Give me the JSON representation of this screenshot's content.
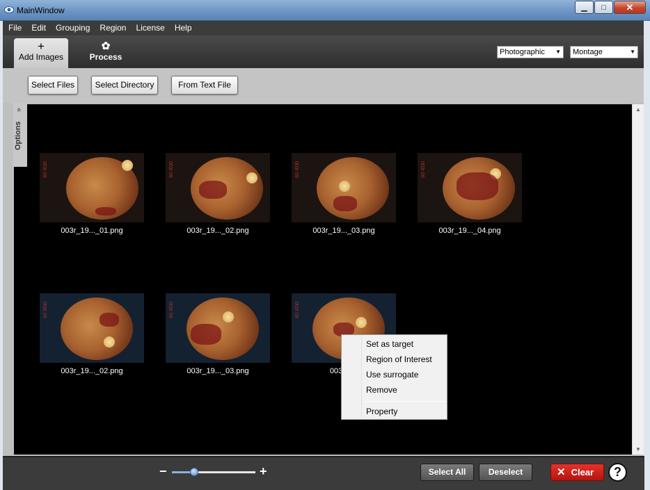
{
  "window": {
    "title": "MainWindow",
    "minimize": "▁",
    "maximize": "□",
    "close": "✕"
  },
  "menu": [
    "File",
    "Edit",
    "Grouping",
    "Region",
    "License",
    "Help"
  ],
  "tabs": {
    "add_images": {
      "icon": "plus-icon",
      "glyph": "+",
      "label": "Add Images"
    },
    "process": {
      "icon": "gear-icon",
      "glyph": "✿",
      "label": "Process"
    }
  },
  "selects": {
    "mode": {
      "value": "Photographic"
    },
    "view": {
      "value": "Montage"
    }
  },
  "buttons": {
    "select_files": "Select Files",
    "select_directory": "Select Directory",
    "from_text_file": "From Text File"
  },
  "options_tab": {
    "label": "Options",
    "chevron": "«"
  },
  "thumbnails": [
    {
      "caption": "003r_19..._01.png",
      "stamp": "003r 09"
    },
    {
      "caption": "003r_19..._02.png",
      "stamp": "003r 09"
    },
    {
      "caption": "003r_19..._03.png",
      "stamp": "003r 09"
    },
    {
      "caption": "003r_19..._04.png",
      "stamp": "003r 09"
    },
    {
      "caption": "003r_19..._02.png",
      "stamp": "003r 09"
    },
    {
      "caption": "003r_19..._03.png",
      "stamp": "003r 09"
    },
    {
      "caption": "003r_19",
      "stamp": "003r 09"
    }
  ],
  "context_menu": [
    "Set as target",
    "Region of Interest",
    "Use surrogate",
    "Remove",
    "Property"
  ],
  "bottom": {
    "zoom_minus": "−",
    "zoom_plus": "+",
    "zoom_level": 0.27,
    "select_all": "Select All",
    "deselect": "Deselect",
    "clear": "Clear",
    "clear_icon": "✕",
    "help": "?"
  },
  "colors": {
    "clear_button": "#d6221b",
    "slider_handle": "#5a8fd1"
  }
}
